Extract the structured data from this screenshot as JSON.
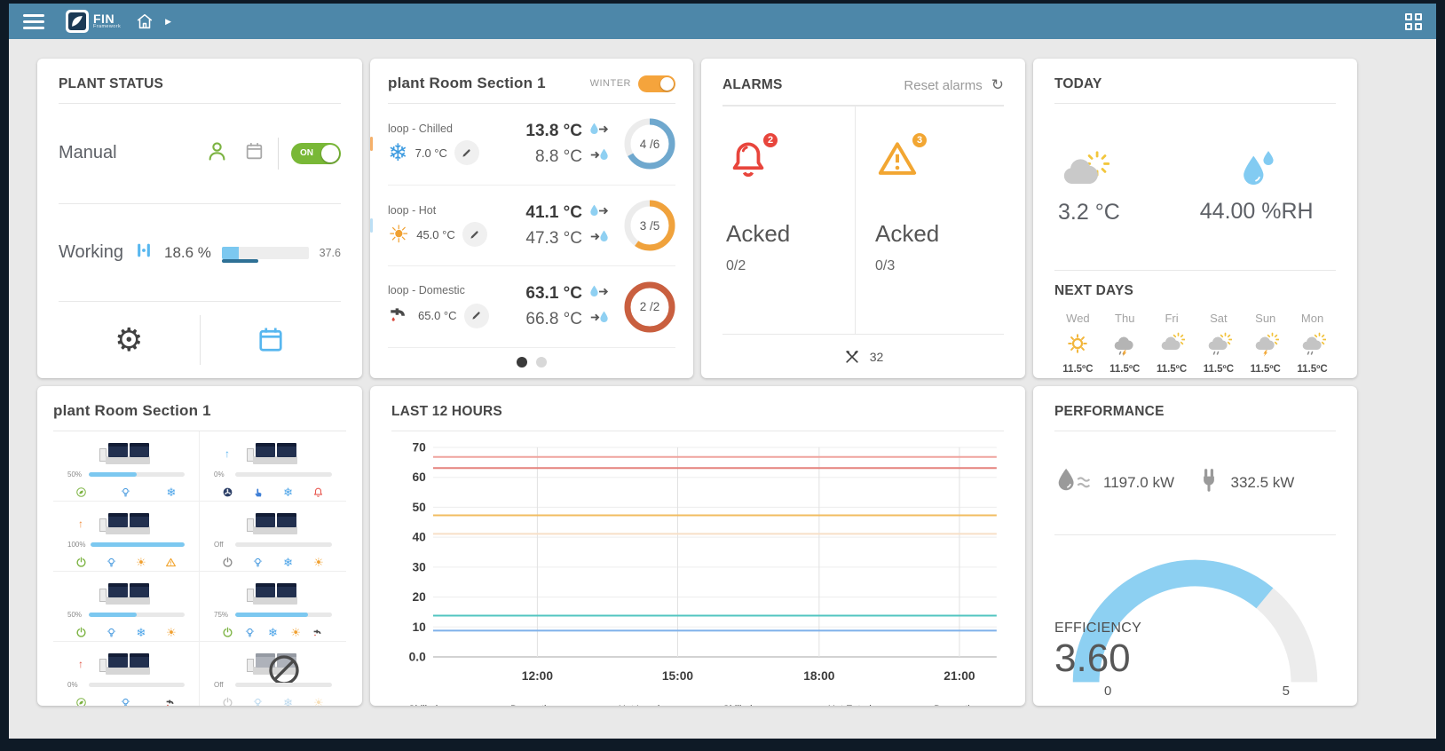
{
  "navbar": {
    "logo_text": "FIN",
    "logo_sub": "Framework"
  },
  "glyphs": {
    "gear": "⚙",
    "refresh": "↻",
    "caret": "▶",
    "snowflake": "❄",
    "sun": "☀",
    "arrow_up": "↑"
  },
  "plant_status": {
    "title": "PLANT STATUS",
    "mode_label": "Manual",
    "toggle_label": "ON",
    "working_label": "Working",
    "working_pct": "18.6 %",
    "working_value": "37.6",
    "bar_fill_pct": 20,
    "bar_under_pct": 42
  },
  "plant_room": {
    "title": "plant Room Section 1",
    "season_label": "WINTER",
    "loops": [
      {
        "name": "loop - Chilled",
        "setpoint": "7.0 °C",
        "supply": "13.8 °C",
        "return": "8.8 °C",
        "count": "4 /6",
        "ring_color": "#6fa8ce",
        "ring_frac": 0.667,
        "tick_color": "#f5b06a"
      },
      {
        "name": "loop - Hot",
        "setpoint": "45.0 °C",
        "supply": "41.1 °C",
        "return": "47.3 °C",
        "count": "3 /5",
        "ring_color": "#f0a23c",
        "ring_frac": 0.6,
        "tick_color": "#bcdff5"
      },
      {
        "name": "loop - Domestic",
        "setpoint": "65.0 °C",
        "supply": "63.1 °C",
        "return": "66.8 °C",
        "count": "2 /2",
        "ring_color": "#c95f3f",
        "ring_frac": 1,
        "tick_color": ""
      }
    ]
  },
  "alarms": {
    "title": "ALARMS",
    "reset_label": "Reset alarms",
    "columns": [
      {
        "badge": "2",
        "badge_color": "#e8453c",
        "status": "Acked",
        "count": "0/2"
      },
      {
        "badge": "3",
        "badge_color": "#f2a632",
        "status": "Acked",
        "count": "0/3"
      }
    ],
    "maintenance_count": "32"
  },
  "today": {
    "title": "TODAY",
    "temperature": "3.2 °C",
    "humidity": "44.00 %RH",
    "next_days_label": "NEXT DAYS",
    "days": [
      {
        "name": "Wed",
        "icon": "sunny",
        "temp": "11.5ºC"
      },
      {
        "name": "Thu",
        "icon": "storm",
        "temp": "11.5ºC"
      },
      {
        "name": "Fri",
        "icon": "cloud-sun",
        "temp": "11.5ºC"
      },
      {
        "name": "Sat",
        "icon": "cloud-sun-rain",
        "temp": "11.5ºC"
      },
      {
        "name": "Sun",
        "icon": "cloud-sun-storm",
        "temp": "11.5ºC"
      },
      {
        "name": "Mon",
        "icon": "cloud-sun-rain",
        "temp": "11.5ºC"
      }
    ]
  },
  "equipment": {
    "title": "plant Room Section 1",
    "units": [
      {
        "load": "50%",
        "fill": 50,
        "arrow": null,
        "disabled": false,
        "icons": [
          {
            "type": "leaf",
            "color": "#7cb342"
          },
          {
            "type": "bulb",
            "color": "#4d9de0"
          },
          {
            "type": "snowflake",
            "color": "#4aa3e8"
          }
        ]
      },
      {
        "load": "0%",
        "fill": 0,
        "arrow": "#5ab4f0",
        "disabled": false,
        "icons": [
          {
            "type": "fan",
            "color": "#2b3e66"
          },
          {
            "type": "hand",
            "color": "#3f7fd6"
          },
          {
            "type": "snowflake",
            "color": "#4aa3e8"
          },
          {
            "type": "bell",
            "color": "#e8574f"
          }
        ]
      },
      {
        "load": "100%",
        "fill": 100,
        "arrow": "#f08c3c",
        "disabled": false,
        "icons": [
          {
            "type": "power",
            "color": "#7cb342"
          },
          {
            "type": "bulb",
            "color": "#4d9de0"
          },
          {
            "type": "sun",
            "color": "#f0a030"
          },
          {
            "type": "warning",
            "color": "#f2a632"
          }
        ]
      },
      {
        "load": "Off",
        "fill": 0,
        "arrow": null,
        "disabled": false,
        "icons": [
          {
            "type": "power",
            "color": "#8a8a8a"
          },
          {
            "type": "bulb",
            "color": "#4d9de0"
          },
          {
            "type": "snowflake",
            "color": "#4aa3e8"
          },
          {
            "type": "sun",
            "color": "#f0a030"
          }
        ]
      },
      {
        "load": "50%",
        "fill": 50,
        "arrow": null,
        "disabled": false,
        "icons": [
          {
            "type": "power",
            "color": "#7cb342"
          },
          {
            "type": "bulb",
            "color": "#4d9de0"
          },
          {
            "type": "snowflake",
            "color": "#4aa3e8"
          },
          {
            "type": "sun",
            "color": "#f0a030"
          }
        ]
      },
      {
        "load": "75%",
        "fill": 75,
        "arrow": null,
        "disabled": false,
        "icons": [
          {
            "type": "power",
            "color": "#7cb342"
          },
          {
            "type": "bulb",
            "color": "#4d9de0"
          },
          {
            "type": "snowflake",
            "color": "#4aa3e8"
          },
          {
            "type": "sun",
            "color": "#f0a030"
          },
          {
            "type": "faucet",
            "color": "#4a4a4a"
          }
        ]
      },
      {
        "load": "0%",
        "fill": 0,
        "arrow": "#e05545",
        "disabled": false,
        "icons": [
          {
            "type": "leaf",
            "color": "#7cb342"
          },
          {
            "type": "bulb",
            "color": "#4d9de0"
          },
          {
            "type": "faucet",
            "color": "#4a4a4a"
          }
        ]
      },
      {
        "load": "Off",
        "fill": 0,
        "arrow": null,
        "disabled": true,
        "icons": [
          {
            "type": "power",
            "color": "#9a9a9a"
          },
          {
            "type": "bulb",
            "color": "#7fb6de"
          },
          {
            "type": "snowflake",
            "color": "#7fb6de"
          },
          {
            "type": "sun",
            "color": "#f0c070"
          }
        ]
      }
    ]
  },
  "chart_data": {
    "type": "line",
    "title": "LAST 12 HOURS",
    "x_ticks": [
      "12:00",
      "15:00",
      "18:00",
      "21:00"
    ],
    "x_tick_fractions": [
      0.185,
      0.434,
      0.685,
      0.934
    ],
    "y_ticks": [
      "70",
      "60",
      "50",
      "40",
      "30",
      "20",
      "10",
      "0.0"
    ],
    "y_tick_values": [
      70,
      60,
      50,
      40,
      30,
      20,
      10,
      0
    ],
    "ylim": [
      0,
      70
    ],
    "grid": true,
    "legend_position": "bottom",
    "series": [
      {
        "name": "Chilled Enteri...",
        "color": "#4dc5bd",
        "line_color": "#52c5c0",
        "value": 13.8
      },
      {
        "name": "Domestic Leav...",
        "color": "#c9304a",
        "line_color": "#e5827d",
        "value": 63.1
      },
      {
        "name": "Hot Leaving T...",
        "color": "#f2a43c",
        "line_color": "#f2bc60",
        "value": 47.3
      },
      {
        "name": "Chilled Leavin...",
        "color": "#4185f0",
        "line_color": "#7fb1ea",
        "value": 8.8
      },
      {
        "name": "Hot Entering T...",
        "color": "#f7d9bd",
        "line_color": "#f7dfc6",
        "value": 41.1
      },
      {
        "name": "Domestic Ente...",
        "color": "#e0837d",
        "line_color": "#efa39d",
        "value": 66.8
      }
    ]
  },
  "performance": {
    "title": "PERFORMANCE",
    "thermal_power": "1197.0 kW",
    "electric_power": "332.5 kW",
    "gauge": {
      "label": "EFFICIENCY",
      "value": "3.60",
      "min": "0",
      "max": "5",
      "fraction": 0.72,
      "color": "#8dd0f2"
    }
  }
}
